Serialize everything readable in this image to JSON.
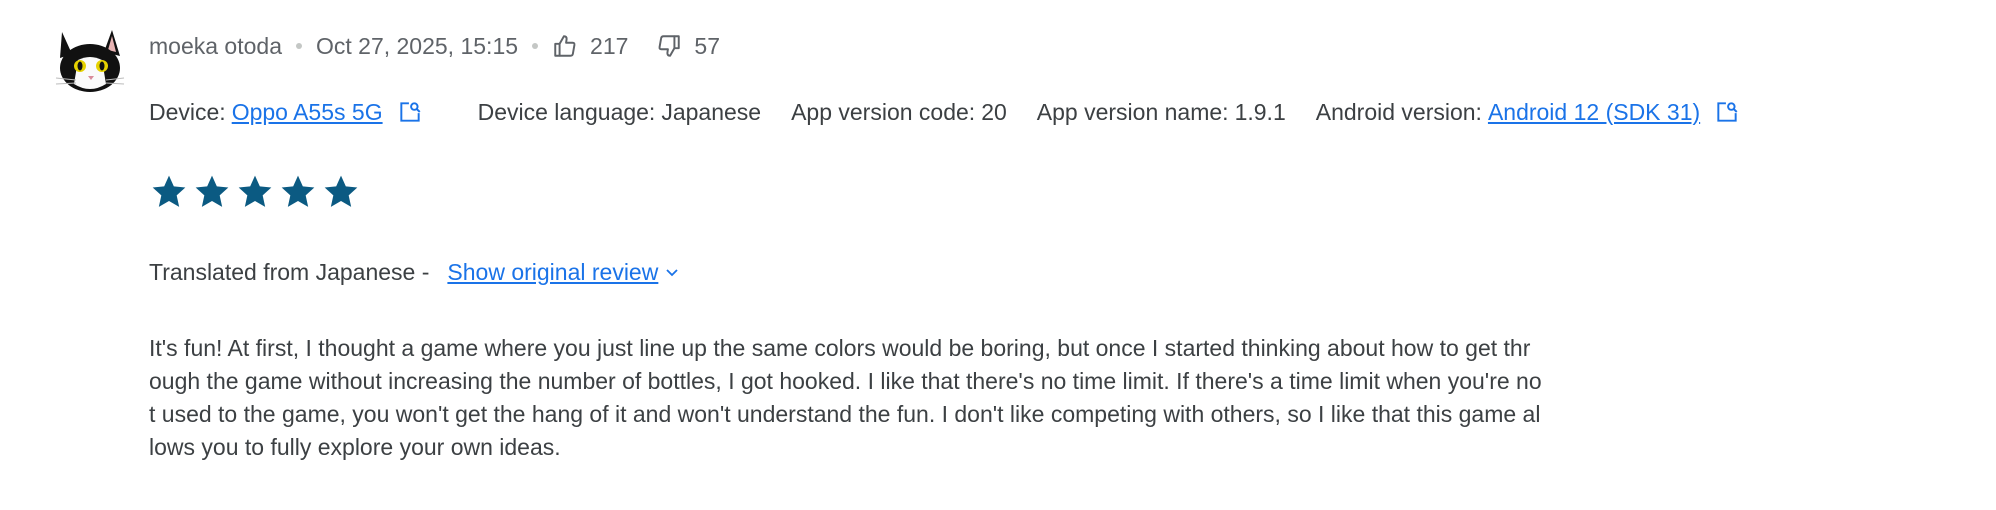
{
  "review": {
    "author": "moeka otoda",
    "date": "Oct 27, 2025, 15:15",
    "thumbs_up_count": "217",
    "thumbs_down_count": "57",
    "avatar_icon": "cat-avatar-icon",
    "meta": {
      "device_label": "Device:",
      "device_value": "Oppo A55s 5G",
      "device_language_label": "Device language:",
      "device_language_value": "Japanese",
      "app_version_code_label": "App version code:",
      "app_version_code_value": "20",
      "app_version_name_label": "App version name:",
      "app_version_name_value": "1.9.1",
      "android_version_label": "Android version:",
      "android_version_value": "Android 12 (SDK 31)"
    },
    "rating": 5,
    "rating_max": 5,
    "star_color": "#0b5a82",
    "translated_from": "Translated from Japanese -",
    "show_original_label": "Show original review",
    "text_lines": [
      "It's fun! At first, I thought a game where you just line up the same colors would be boring, but once I started thinking about how to get thr",
      "ough the game without increasing the number of bottles, I got hooked. I like that there's no time limit. If there's a time limit when you're no",
      "t used to the game, you won't get the hang of it and won't understand the fun. I don't like competing with others, so I like that this game al",
      "lows you to fully explore your own ideas."
    ]
  },
  "colors": {
    "link": "#1a73e8",
    "text": "#3c4043",
    "muted": "#5f6368",
    "star": "#0b5a82"
  }
}
